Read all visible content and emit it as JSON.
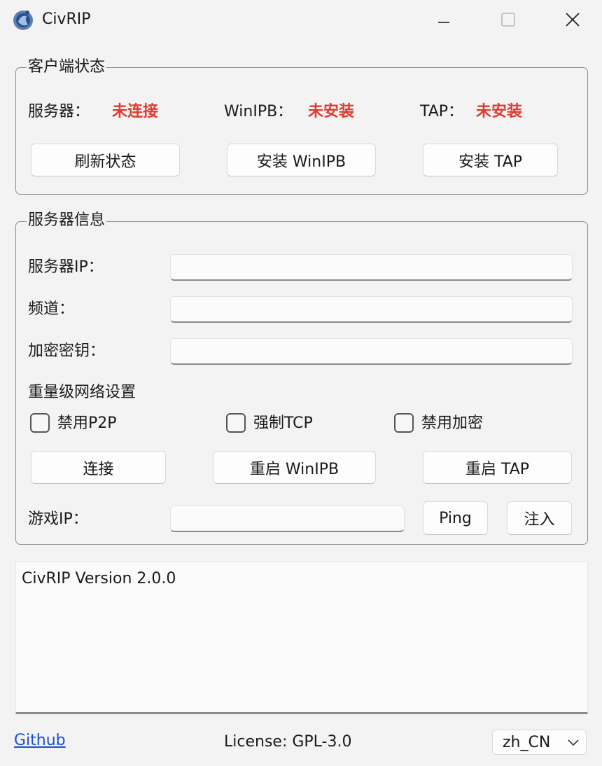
{
  "window": {
    "title": "CivRIP",
    "controls": [
      "minimize-icon",
      "maximize-icon",
      "close-icon"
    ]
  },
  "client_status": {
    "title": "客户端状态",
    "server_label": "服务器：",
    "server_value": "未连接",
    "winipb_label": "WinIPB：",
    "winipb_value": "未安装",
    "tap_label": "TAP：",
    "tap_value": "未安装",
    "buttons": {
      "refresh": "刷新状态",
      "install_winipb": "安装 WinIPB",
      "install_tap": "安装 TAP"
    },
    "status_color": "#e03b2f"
  },
  "server_info": {
    "title": "服务器信息",
    "server_ip_label": "服务器IP：",
    "server_ip_value": "",
    "channel_label": "频道：",
    "channel_value": "",
    "key_label": "加密密钥：",
    "key_value": "",
    "heavy_settings_label": "重量级网络设置",
    "checkboxes": {
      "disable_p2p": "禁用P2P",
      "force_tcp": "强制TCP",
      "disable_encryption": "禁用加密"
    },
    "buttons": {
      "connect": "连接",
      "restart_winipb": "重启 WinIPB",
      "restart_tap": "重启 TAP",
      "ping": "Ping",
      "inject": "注入"
    },
    "game_ip_label": "游戏IP：",
    "game_ip_value": ""
  },
  "log": {
    "text": "CivRIP Version 2.0.0"
  },
  "footer": {
    "github_link": "Github",
    "license": "License: GPL-3.0",
    "language": "zh_CN"
  },
  "colors": {
    "accent_link": "#1a4fd6",
    "window_bg": "#f3f3f3"
  }
}
